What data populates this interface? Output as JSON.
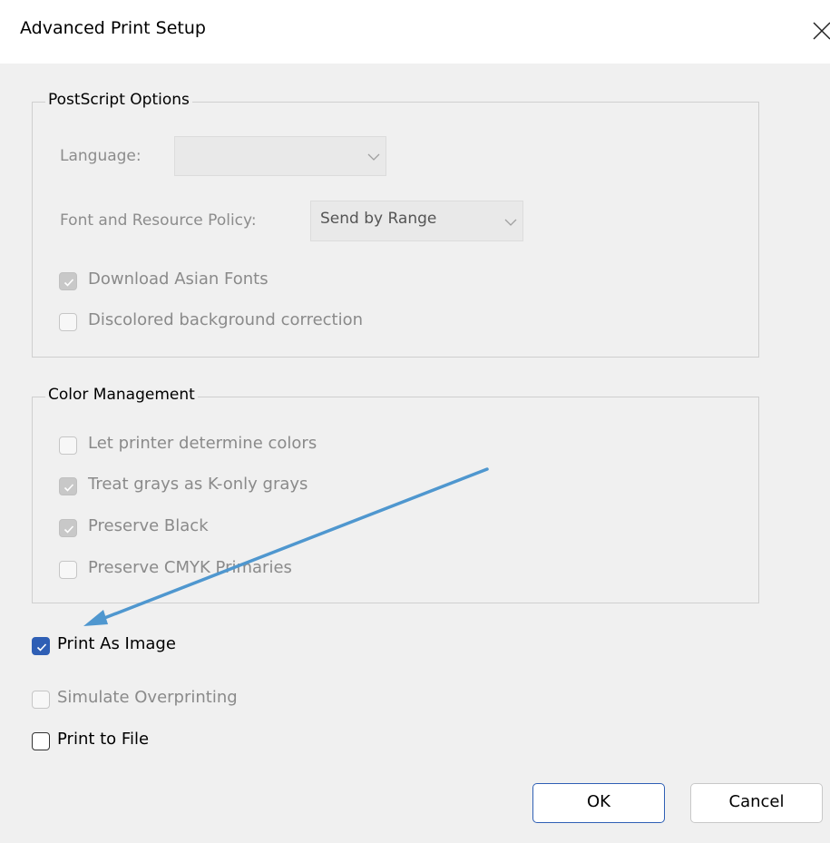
{
  "window": {
    "title": "Advanced Print Setup",
    "close_icon": "close-icon"
  },
  "postscript": {
    "legend": "PostScript Options",
    "language_label": "Language:",
    "language_value": "",
    "font_policy_label": "Font and Resource Policy:",
    "font_policy_value": "Send by Range",
    "download_asian_fonts": {
      "label": "Download Asian Fonts",
      "checked": true,
      "enabled": false
    },
    "discolored_bg": {
      "label": "Discolored background correction",
      "checked": false,
      "enabled": false
    }
  },
  "color_management": {
    "legend": "Color Management",
    "let_printer": {
      "label": "Let printer determine colors",
      "checked": false,
      "enabled": false
    },
    "treat_grays": {
      "label": "Treat grays as K-only grays",
      "checked": true,
      "enabled": false
    },
    "preserve_black": {
      "label": "Preserve Black",
      "checked": true,
      "enabled": false
    },
    "preserve_cmyk": {
      "label": "Preserve CMYK Primaries",
      "checked": false,
      "enabled": false
    }
  },
  "options": {
    "print_as_image": {
      "label": "Print As Image",
      "checked": true,
      "enabled": true
    },
    "simulate_overprinting": {
      "label": "Simulate Overprinting",
      "checked": false,
      "enabled": false
    },
    "print_to_file": {
      "label": "Print to File",
      "checked": false,
      "enabled": true
    }
  },
  "buttons": {
    "ok_label": "OK",
    "cancel_label": "Cancel"
  },
  "colors": {
    "accent": "#2f5fb5",
    "annotation_arrow": "#4f97cf",
    "dialog_bg": "#f0f0f0"
  }
}
